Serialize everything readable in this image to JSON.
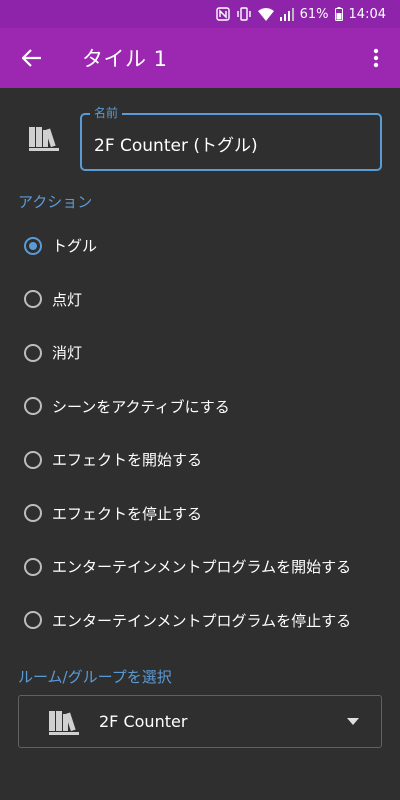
{
  "status_bar": {
    "battery_percent": "61%",
    "time": "14:04",
    "icons": [
      "nfc-icon",
      "vibrate-icon",
      "wifi-icon",
      "signal-icon",
      "battery-icon"
    ]
  },
  "app_bar": {
    "title": "タイル 1",
    "back_icon": "arrow-left-icon",
    "menu_icon": "more-vert-icon",
    "color": "#9c27b0"
  },
  "name_field": {
    "label": "名前",
    "value": "2F Counter (トグル)",
    "icon": "books-icon",
    "accent_color": "#5b9bd5"
  },
  "actions": {
    "header": "アクション",
    "selected_index": 0,
    "options": [
      {
        "label": "トグル",
        "selected": true
      },
      {
        "label": "点灯",
        "selected": false
      },
      {
        "label": "消灯",
        "selected": false
      },
      {
        "label": "シーンをアクティブにする",
        "selected": false
      },
      {
        "label": "エフェクトを開始する",
        "selected": false
      },
      {
        "label": "エフェクトを停止する",
        "selected": false
      },
      {
        "label": "エンターテインメントプログラムを開始する",
        "selected": false
      },
      {
        "label": "エンターテインメントプログラムを停止する",
        "selected": false
      }
    ]
  },
  "room_group": {
    "header": "ルーム/グループを選択",
    "selected_value": "2F Counter",
    "icon": "books-icon"
  }
}
